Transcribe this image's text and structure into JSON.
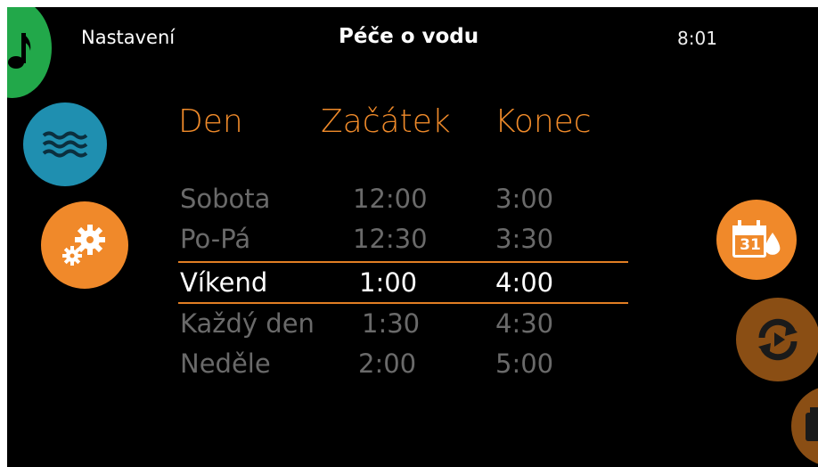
{
  "header": {
    "left_title": "Nastavení",
    "center_title": "Péče o vodu",
    "clock": "8:01"
  },
  "table": {
    "columns": [
      "Den",
      "Začátek",
      "Konec"
    ],
    "rows": [
      {
        "day": "Sobota",
        "start": "12:00",
        "end": "3:00",
        "selected": false
      },
      {
        "day": "Po-Pá",
        "start": "12:30",
        "end": "3:30",
        "selected": false
      },
      {
        "day": "Víkend",
        "start": "1:00",
        "end": "4:00",
        "selected": true
      },
      {
        "day": "Každý den",
        "start": "1:30",
        "end": "4:30",
        "selected": false
      },
      {
        "day": "Neděle",
        "start": "2:00",
        "end": "5:00",
        "selected": false
      }
    ]
  },
  "left_nav": [
    {
      "icon": "music-note-icon",
      "color": "#22a84a"
    },
    {
      "icon": "water-waves-icon",
      "color": "#1f8fb0"
    },
    {
      "icon": "gears-icon",
      "color": "#f0892a"
    }
  ],
  "right_nav": [
    {
      "icon": "calendar-water-icon",
      "color": "#f0892a",
      "calendar_day": "31"
    },
    {
      "icon": "refresh-cycle-icon",
      "color": "#8a4e14"
    },
    {
      "icon": "filter-icon",
      "color": "#8a4e14"
    }
  ],
  "colors": {
    "accent": "#ef8a2a",
    "background": "#000000",
    "selected_text": "#ffffff",
    "dim_text": "#6a6a6a"
  }
}
